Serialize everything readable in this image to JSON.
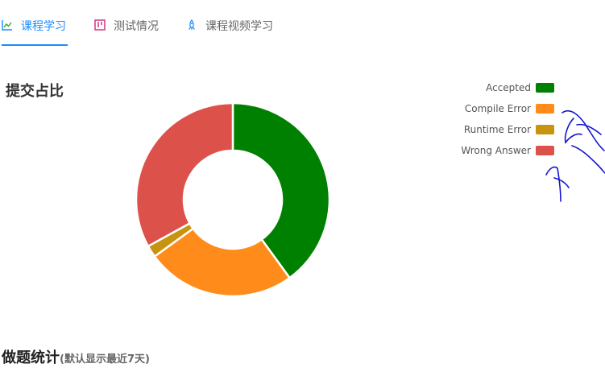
{
  "tabs": [
    {
      "label": "课程学习",
      "icon": "trend-line-icon",
      "active": true,
      "color": "#1a8cff"
    },
    {
      "label": "测试情况",
      "icon": "board-icon",
      "active": false,
      "color": "#d63384"
    },
    {
      "label": "课程视频学习",
      "icon": "rocket-icon",
      "active": false,
      "color": "#1a8cff"
    }
  ],
  "section_title": "提交占比",
  "bottom_section": {
    "title": "做题统计",
    "note": "(默认显示最近7天)"
  },
  "chart_data": {
    "type": "pie",
    "variant": "donut",
    "title": "",
    "categories": [
      "Accepted",
      "Compile Error",
      "Runtime Error",
      "Wrong Answer"
    ],
    "values": [
      40,
      25,
      2,
      33
    ],
    "colors": [
      "#008000",
      "#ff8c1a",
      "#c8940f",
      "#dc524a"
    ],
    "legend_position": "top-right"
  }
}
